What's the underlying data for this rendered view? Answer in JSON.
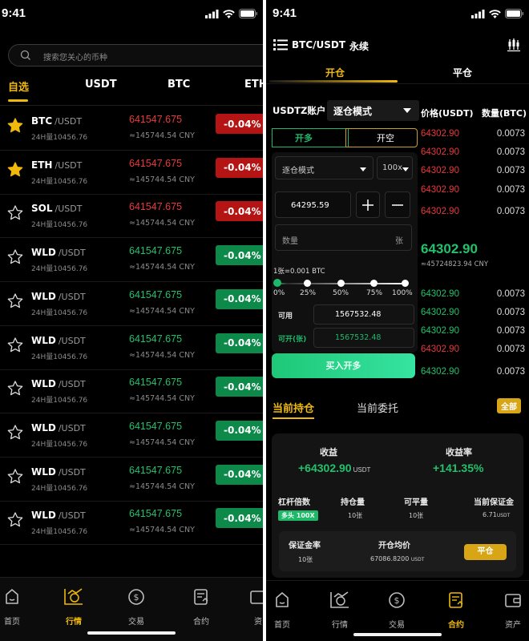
{
  "left": {
    "status_time": "9:41",
    "search_placeholder": "搜索您关心的币种",
    "tabs": [
      "自选",
      "USDT",
      "BTC",
      "ETH"
    ],
    "coins": [
      {
        "symbol": "BTC",
        "quote": "/USDT",
        "volume": "24H量10456.76",
        "price": "641547.675",
        "cny": "≈145744.54 CNY",
        "change": "-0.04%",
        "direction": "down",
        "favorite": true
      },
      {
        "symbol": "ETH",
        "quote": "/USDT",
        "volume": "24H量10456.76",
        "price": "641547.675",
        "cny": "≈145744.54 CNY",
        "change": "-0.04%",
        "direction": "down",
        "favorite": true
      },
      {
        "symbol": "SOL",
        "quote": "/USDT",
        "volume": "24H量10456.76",
        "price": "641547.675",
        "cny": "≈145744.54 CNY",
        "change": "-0.04%",
        "direction": "down",
        "favorite": false
      },
      {
        "symbol": "WLD",
        "quote": "/USDT",
        "volume": "24H量10456.76",
        "price": "641547.675",
        "cny": "≈145744.54 CNY",
        "change": "-0.04%",
        "direction": "up",
        "favorite": false
      },
      {
        "symbol": "WLD",
        "quote": "/USDT",
        "volume": "24H量10456.76",
        "price": "641547.675",
        "cny": "≈145744.54 CNY",
        "change": "-0.04%",
        "direction": "up",
        "favorite": false
      },
      {
        "symbol": "WLD",
        "quote": "/USDT",
        "volume": "24H量10456.76",
        "price": "641547.675",
        "cny": "≈145744.54 CNY",
        "change": "-0.04%",
        "direction": "up",
        "favorite": false
      },
      {
        "symbol": "WLD",
        "quote": "/USDT",
        "volume": "24H量10456.76",
        "price": "641547.675",
        "cny": "≈145744.54 CNY",
        "change": "-0.04%",
        "direction": "up",
        "favorite": false
      },
      {
        "symbol": "WLD",
        "quote": "/USDT",
        "volume": "24H量10456.76",
        "price": "641547.675",
        "cny": "≈145744.54 CNY",
        "change": "-0.04%",
        "direction": "up",
        "favorite": false
      },
      {
        "symbol": "WLD",
        "quote": "/USDT",
        "volume": "24H量10456.76",
        "price": "641547.675",
        "cny": "≈145744.54 CNY",
        "change": "-0.04%",
        "direction": "up",
        "favorite": false
      },
      {
        "symbol": "WLD",
        "quote": "/USDT",
        "volume": "24H量10456.76",
        "price": "641547.675",
        "cny": "≈145744.54 CNY",
        "change": "-0.04%",
        "direction": "up",
        "favorite": false
      }
    ],
    "nav": [
      "首页",
      "行情",
      "交易",
      "合约",
      "资"
    ]
  },
  "right": {
    "status_time": "9:41",
    "pair": "BTC/USDT",
    "contract_type": "永续",
    "tab_open": "开仓",
    "tab_close": "平仓",
    "account_label": "USDTZ账户",
    "mode_select": "逐仓模式",
    "price_header": "价格(USDT)",
    "qty_header": "数量(BTC)",
    "btn_long": "开多",
    "btn_short": "开空",
    "mode_select_small": "逐仓模式",
    "leverage": "100x",
    "price_input": "64295.59",
    "qty_placeholder": "数量",
    "qty_unit": "张",
    "contract_note": "1张=0.001 BTC",
    "slider_labels": [
      "0%",
      "25%",
      "50%",
      "75%",
      "100%"
    ],
    "slider_value_percent": 0,
    "available_label": "可用",
    "available_value": "1567532.48",
    "openable_label": "可开(张)",
    "openable_value": "1567532.48",
    "buy_button": "买入开多",
    "asks": [
      {
        "price": "64302.90",
        "qty": "0.0073"
      },
      {
        "price": "64302.90",
        "qty": "0.0073"
      },
      {
        "price": "64302.90",
        "qty": "0.0073"
      },
      {
        "price": "64302.90",
        "qty": "0.0073"
      },
      {
        "price": "64302.90",
        "qty": "0.0073"
      }
    ],
    "last_price": "64302.90",
    "last_price_cny": "≈45724823.94 CNY",
    "bids": [
      {
        "price": "64302.90",
        "qty": "0.0073",
        "side": "up"
      },
      {
        "price": "64302.90",
        "qty": "0.0073",
        "side": "up"
      },
      {
        "price": "64302.90",
        "qty": "0.0073",
        "side": "up"
      },
      {
        "price": "64302.90",
        "qty": "0.0073",
        "side": "down"
      },
      {
        "price": "64302.90",
        "qty": "0.0073",
        "side": "up"
      }
    ],
    "pos_tab": "当前持仓",
    "orders_tab": "当前委托",
    "all_button": "全部",
    "position": {
      "pnl_label": "收益",
      "pnl_value": "+64302.90",
      "pnl_unit": "USDT",
      "roe_label": "收益率",
      "roe_value": "+141.35%",
      "leverage_label": "杠杆倍数",
      "leverage_badge": "多头 100X",
      "hold_label": "持仓量",
      "hold_value": "10张",
      "closable_label": "可平量",
      "closable_value": "10张",
      "margin_label": "当前保证金",
      "margin_value": "6.71",
      "margin_unit": "USDT",
      "margin_rate_label": "保证金率",
      "margin_rate_value": "10张",
      "avg_label": "开仓均价",
      "avg_value": "67086.8200",
      "avg_unit": "USDT",
      "close_button": "平仓"
    },
    "nav": [
      "首页",
      "行情",
      "交易",
      "合约",
      "资产"
    ]
  },
  "colors": {
    "accent": "#f0b90b",
    "up": "#23c16b",
    "down": "#e8393b"
  }
}
